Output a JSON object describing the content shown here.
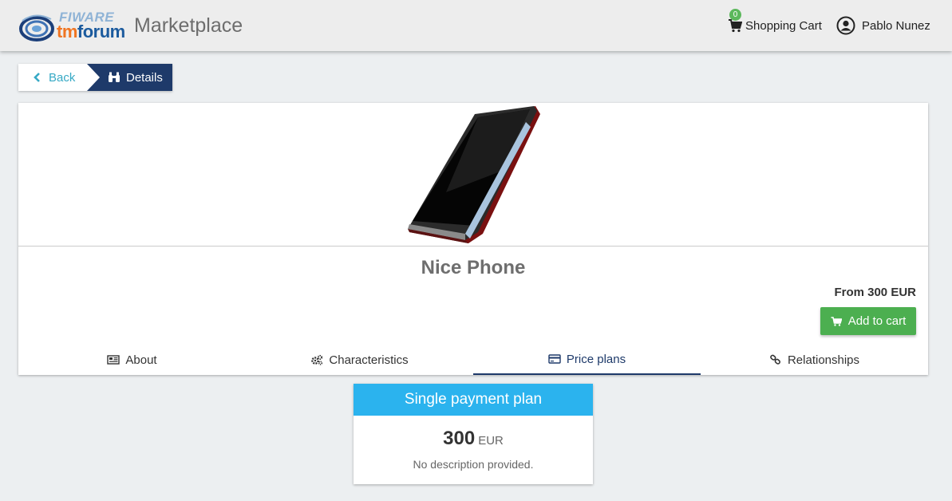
{
  "header": {
    "logo_text_top": "FIWARE",
    "logo_text_tm": "tm",
    "logo_text_forum": "forum",
    "app_title": "Marketplace",
    "cart_count": "0",
    "cart_label": "Shopping Cart",
    "user_name": "Pablo Nunez",
    "icons": {
      "cart": "cart-icon",
      "user": "user-circle-icon"
    }
  },
  "breadcrumb": {
    "back_label": "Back",
    "details_label": "Details",
    "icons": {
      "back": "chevron-left-icon",
      "details": "binoculars-icon"
    }
  },
  "product": {
    "name": "Nice Phone",
    "price_text": "From 300 EUR",
    "add_to_cart_label": "Add to cart",
    "image": "smartphone-image"
  },
  "tabs": [
    {
      "label": "About",
      "icon": "newspaper-icon",
      "active": false
    },
    {
      "label": "Characteristics",
      "icon": "cogs-icon",
      "active": false
    },
    {
      "label": "Price plans",
      "icon": "credit-card-icon",
      "active": true
    },
    {
      "label": "Relationships",
      "icon": "link-icon",
      "active": false
    }
  ],
  "price_plan": {
    "title": "Single payment plan",
    "amount": "300",
    "currency": "EUR",
    "description": "No description provided."
  },
  "colors": {
    "navy": "#1e3a6a",
    "accent_teal": "#36a9c5",
    "success_green": "#4caf50",
    "plan_blue": "#2bb3ee"
  }
}
